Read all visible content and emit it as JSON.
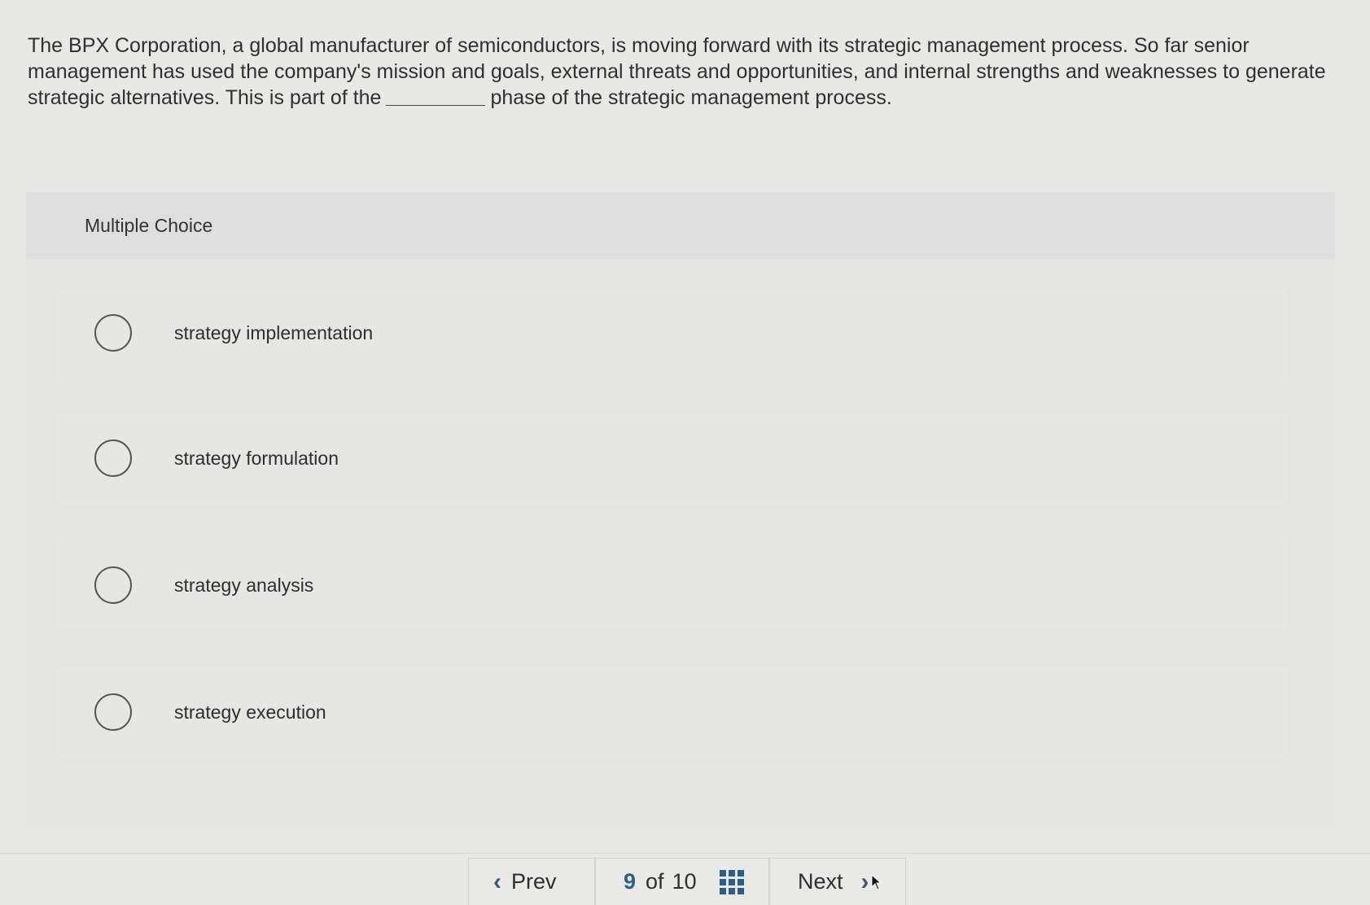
{
  "question": {
    "text_before": "The BPX Corporation, a global manufacturer of semiconductors, is moving forward with its strategic management process. So far senior management has used the company's mission and goals, external threats and opportunities, and internal strengths and weaknesses to generate strategic alternatives. This is part of the",
    "text_after": "phase of the strategic management process."
  },
  "multiple_choice": {
    "header": "Multiple Choice",
    "options": [
      {
        "label": "strategy implementation"
      },
      {
        "label": "strategy formulation"
      },
      {
        "label": "strategy analysis"
      },
      {
        "label": "strategy execution"
      }
    ]
  },
  "nav": {
    "prev_icon": "chevron-left-icon",
    "prev_label": "Prev",
    "current": "9",
    "of_label": "of",
    "total": "10",
    "grid_icon": "grid-icon",
    "next_label": "Next",
    "next_icon": "chevron-right-icon"
  },
  "colors": {
    "accent": "#2c5f86",
    "background": "#e8e8e6"
  }
}
